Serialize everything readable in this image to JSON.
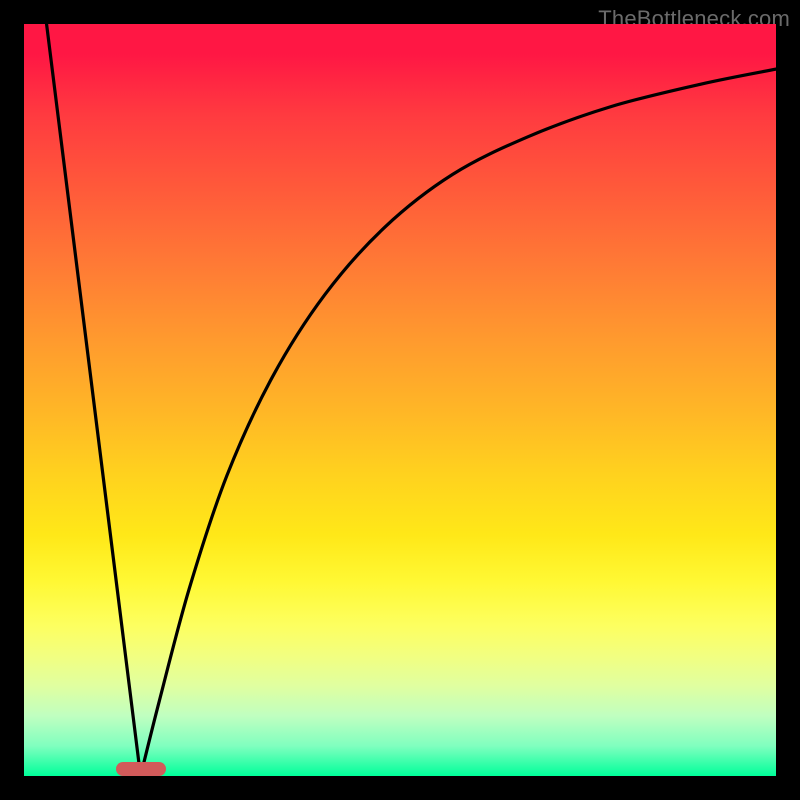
{
  "watermark": "TheBottleneck.com",
  "chart_data": {
    "type": "line",
    "title": "",
    "xlabel": "",
    "ylabel": "",
    "xlim": [
      0,
      100
    ],
    "ylim": [
      0,
      100
    ],
    "optimum_x": 15.5,
    "series": [
      {
        "name": "left-slope",
        "x": [
          3,
          15.5
        ],
        "y": [
          100,
          0
        ]
      },
      {
        "name": "right-curve",
        "x": [
          15.5,
          18,
          22,
          27,
          33,
          40,
          48,
          57,
          67,
          78,
          90,
          100
        ],
        "y": [
          0,
          10,
          25,
          40,
          53,
          64,
          73,
          80,
          85,
          89,
          92,
          94
        ]
      }
    ],
    "marker": {
      "x": 15.5,
      "y": 0
    },
    "gradient_stops": [
      {
        "pos": 0,
        "color": "#ff1744"
      },
      {
        "pos": 50,
        "color": "#ffb826"
      },
      {
        "pos": 78,
        "color": "#fff833"
      },
      {
        "pos": 100,
        "color": "#00ff9a"
      }
    ]
  }
}
